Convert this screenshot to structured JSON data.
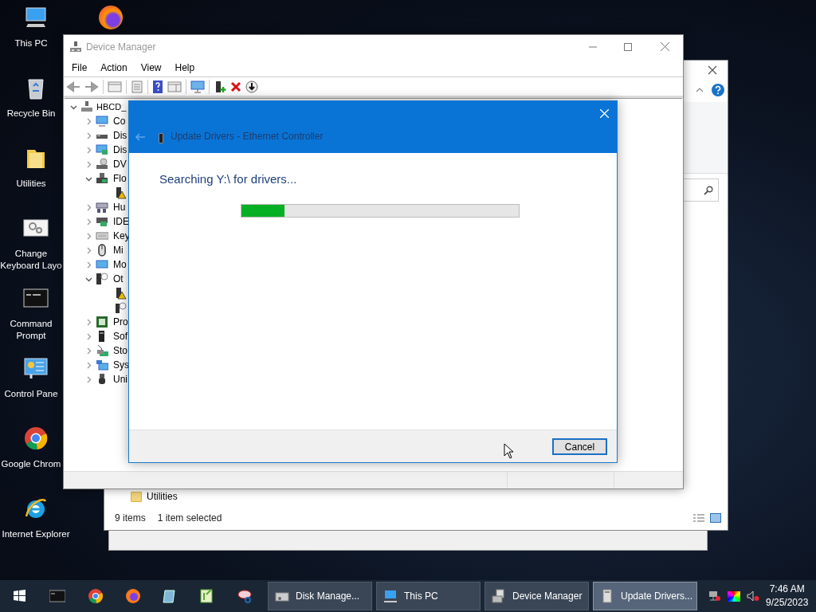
{
  "desktop_icons": [
    {
      "label": "This PC"
    },
    {
      "label": "Recycle Bin"
    },
    {
      "label": "Utilities"
    },
    {
      "label": "Change Keyboard Layo"
    },
    {
      "label": "Command Prompt"
    },
    {
      "label": "Control Pane"
    },
    {
      "label": "Google Chrom"
    },
    {
      "label": "Internet Explorer"
    }
  ],
  "explorer": {
    "folder_row": "Utilities",
    "status_bar": [
      "9 items",
      "1 item selected"
    ]
  },
  "device_manager": {
    "title": "Device Manager",
    "menu": [
      "File",
      "Action",
      "View",
      "Help"
    ],
    "tree": [
      {
        "label": "HBCD_",
        "expanded": true,
        "children": [
          {
            "label": "Co",
            "expanded": false
          },
          {
            "label": "Dis",
            "expanded": false
          },
          {
            "label": "Dis",
            "expanded": false
          },
          {
            "label": "DV",
            "expanded": false
          },
          {
            "label": "Flo",
            "expanded": true,
            "children": [
              {
                "kind": "warning"
              }
            ]
          },
          {
            "label": "Hu",
            "expanded": false
          },
          {
            "label": "IDE",
            "expanded": false
          },
          {
            "label": "Key",
            "expanded": false
          },
          {
            "label": "Mi",
            "expanded": false
          },
          {
            "label": "Mo",
            "expanded": false
          },
          {
            "label": "Ot",
            "expanded": true,
            "children": [
              {
                "kind": "warning"
              },
              {
                "kind": "unknown"
              }
            ]
          },
          {
            "label": "Pro",
            "expanded": false
          },
          {
            "label": "Sof",
            "expanded": false
          },
          {
            "label": "Sto",
            "expanded": false
          },
          {
            "label": "Sys",
            "expanded": false
          },
          {
            "label": "Uni",
            "expanded": false
          }
        ]
      }
    ]
  },
  "dialog": {
    "title": "Update Drivers - Ethernet Controller",
    "heading": "Searching Y:\\ for drivers...",
    "progress": {
      "level": 0.155
    },
    "buttons": [
      "Cancel"
    ]
  },
  "taskbar": {
    "tasks": [
      {
        "label": "Disk Manage...",
        "selected": false
      },
      {
        "label": "This PC",
        "selected": false
      },
      {
        "label": "Device Manager",
        "selected": false
      },
      {
        "label": "Update Drivers...",
        "selected": true
      }
    ],
    "clock": {
      "time": "7:46 AM",
      "date": "9/25/2023"
    }
  }
}
